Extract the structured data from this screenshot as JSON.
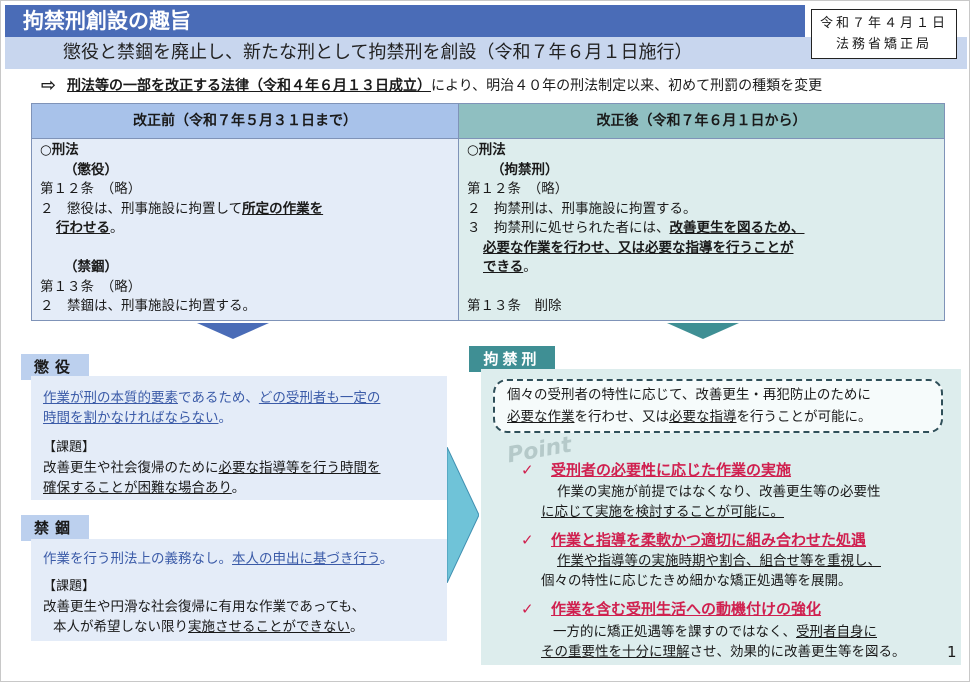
{
  "header": {
    "title": "拘禁刑創設の趣旨",
    "subtitle": "懲役と禁錮を廃止し、新たな刑として拘禁刑を創設（令和７年６月１日施行）",
    "date": "令和７年４月１日",
    "issuer": "法務省矯正局"
  },
  "law_line": {
    "arrow": "⇨",
    "law_name": "刑法等の一部を改正する法律（令和４年６月１３日成立）",
    "rest": "により、明治４０年の刑法制定以来、初めて刑罰の種類を変更"
  },
  "table": {
    "before_header": "改正前（令和７年５月３１日まで）",
    "after_header": "改正後（令和７年６月１日から）",
    "before": {
      "law": "○刑法",
      "sec1": "（懲役）",
      "art12": "第１２条　（略）",
      "art12_2_a": "２　懲役は、刑事施設に拘置して",
      "art12_2_b": "所定の作業を",
      "art12_2_c": "行わせる",
      "art12_2_d": "。",
      "sec2": "（禁錮）",
      "art13": "第１３条　（略）",
      "art13_2": "２　禁錮は、刑事施設に拘置する。"
    },
    "after": {
      "law": "○刑法",
      "sec1": "（拘禁刑）",
      "art12": "第１２条　（略）",
      "art12_2": "２　拘禁刑は、刑事施設に拘置する。",
      "art12_3_a": "３　拘禁刑に処せられた者には、",
      "art12_3_b": "改善更生を図るため、",
      "art12_3_c": "必要な作業を行わせ、又は必要な指導を行うことが",
      "art12_3_d": "できる",
      "art12_3_e": "。",
      "art13": "第１３条　削除"
    }
  },
  "choueki": {
    "tag": "懲役",
    "text_a": "作業が刑の本質的要素",
    "text_b": "であるため、",
    "text_c": "どの受刑者も一定の",
    "text_d": "時間を割かなければならない",
    "text_e": "。",
    "kadai": "【課題】",
    "issue_a": "改善更生や社会復帰のために",
    "issue_b": "必要な指導等を行う時間を",
    "issue_c": "確保することが困難な場合あり",
    "issue_d": "。"
  },
  "kinko": {
    "tag": "禁錮",
    "text_a": "作業を行う刑法上の義務なし。",
    "text_b": "本人の申出に基づき行う",
    "text_c": "。",
    "kadai": "【課題】",
    "issue_a": "改善更生や円滑な社会復帰に有用な作業であっても、",
    "issue_b": "本人が希望しない限り",
    "issue_c": "実施させることができない",
    "issue_d": "。"
  },
  "kokin": {
    "tag": "拘禁刑",
    "summary_1": "個々の受刑者の特性に応じて、改善更生・再犯防止のために",
    "summary_2a": "必要な作業",
    "summary_2b": "を行わせ、又は",
    "summary_2c": "必要な指導",
    "summary_2d": "を行うことが可能に。",
    "point_label": "Point",
    "points": [
      {
        "title": "受刑者の必要性に応じた作業の実施",
        "line1": "作業の実施が前提ではなくなり、改善更生等の必要性",
        "line2": "に応じて実施を検討することが可能に。"
      },
      {
        "title": "作業と指導を柔軟かつ適切に組み合わせた処遇",
        "line1": "作業や指導等の実施時期や割合、組合せ等を重視し、",
        "line2": "個々の特性に応じたきめ細かな矯正処遇等を展開。"
      },
      {
        "title": "作業を含む受刑生活への動機付けの強化",
        "line1a": "一方的に矯正処遇等を課すのではなく、",
        "line1b": "受刑者自身に",
        "line2a": "その重要性を十分に理解",
        "line2b": "させ、効果的に改善更生等を図る。"
      }
    ]
  },
  "page_number": "1",
  "colors": {
    "title_bar": "#4a6cb7",
    "subtitle_bar": "#c8d6ee",
    "teal": "#3f8f94",
    "accent_red": "#d0204f",
    "link_blue": "#3b5ba8"
  }
}
